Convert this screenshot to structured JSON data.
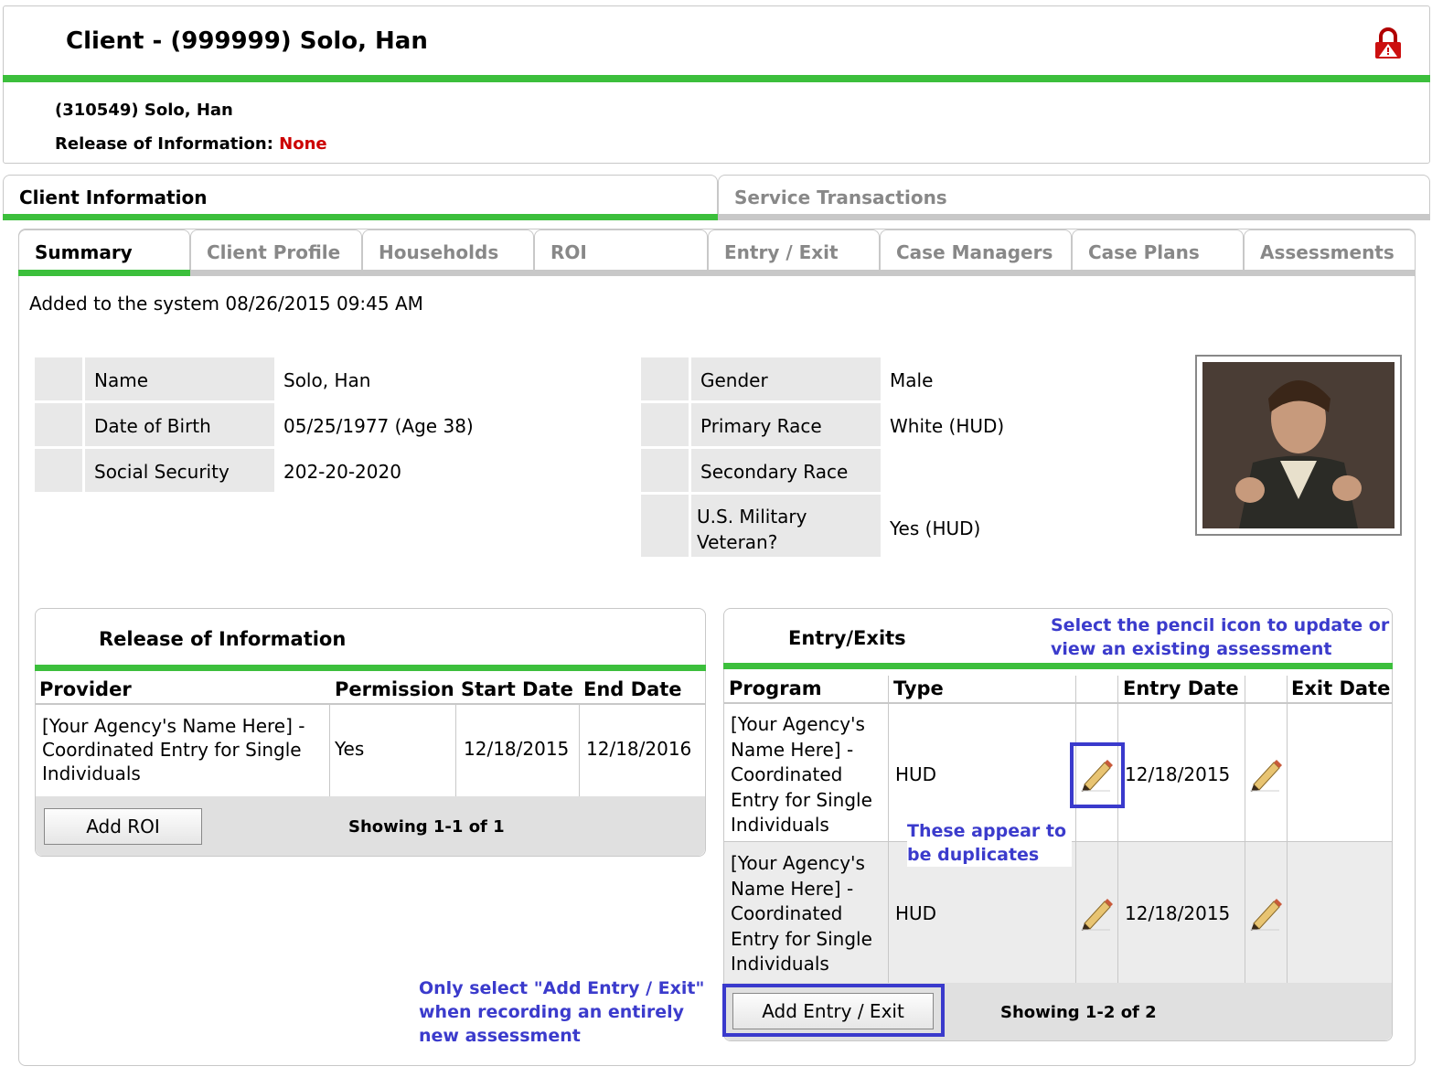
{
  "header": {
    "title": "Client - (999999) Solo, Han",
    "client_line": "(310549) Solo, Han",
    "roi_label": "Release of Information:",
    "roi_value": "None"
  },
  "main_tabs": [
    {
      "label": "Client Information",
      "active": true
    },
    {
      "label": "Service Transactions",
      "active": false
    }
  ],
  "sub_tabs": [
    {
      "label": "Summary",
      "active": true
    },
    {
      "label": "Client Profile"
    },
    {
      "label": "Households"
    },
    {
      "label": "ROI"
    },
    {
      "label": "Entry / Exit"
    },
    {
      "label": "Case Managers"
    },
    {
      "label": "Case Plans"
    },
    {
      "label": "Assessments"
    }
  ],
  "added_text": "Added to the system 08/26/2015 09:45 AM",
  "client_info": {
    "left": [
      {
        "label": "Name",
        "value": "Solo, Han"
      },
      {
        "label": "Date of Birth",
        "value": "05/25/1977 (Age 38)"
      },
      {
        "label": "Social Security",
        "value": "202-20-2020"
      }
    ],
    "right": [
      {
        "label": "Gender",
        "value": "Male"
      },
      {
        "label": "Primary Race",
        "value": "White (HUD)"
      },
      {
        "label": "Secondary Race",
        "value": ""
      },
      {
        "label": "U.S. Military Veteran?",
        "value": "Yes (HUD)"
      }
    ]
  },
  "roi_section": {
    "title": "Release of Information",
    "columns": [
      "Provider",
      "Permission",
      "Start Date",
      "End Date"
    ],
    "rows": [
      {
        "provider": "[Your Agency's Name Here] - Coordinated Entry for Single Individuals",
        "permission": "Yes",
        "start": "12/18/2015",
        "end": "12/18/2016"
      }
    ],
    "add_button": "Add ROI",
    "showing": "Showing 1-1 of 1"
  },
  "entry_section": {
    "title": "Entry/Exits",
    "columns": [
      "Program",
      "Type",
      "",
      "Entry Date",
      "",
      "Exit Date"
    ],
    "rows": [
      {
        "program": "[Your Agency's Name Here] - Coordinated Entry for Single Individuals",
        "type": "HUD",
        "entry": "12/18/2015",
        "exit": ""
      },
      {
        "program": "[Your Agency's Name Here] - Coordinated Entry for Single Individuals",
        "type": "HUD",
        "entry": "12/18/2015",
        "exit": ""
      }
    ],
    "add_button": "Add Entry / Exit",
    "showing": "Showing 1-2 of 2"
  },
  "annotations": {
    "pencil_note": "Select the pencil icon to update or view an existing assessment",
    "duplicate_note": "These appear to be duplicates",
    "add_note": "Only select \"Add Entry / Exit\" when recording an entirely new assessment"
  },
  "colors": {
    "accent_green": "#3cbf3c",
    "annotation_blue": "#3a3acc",
    "alert_red": "#cc0000"
  },
  "icons": [
    "lock-alert-icon",
    "pencil-icon"
  ]
}
